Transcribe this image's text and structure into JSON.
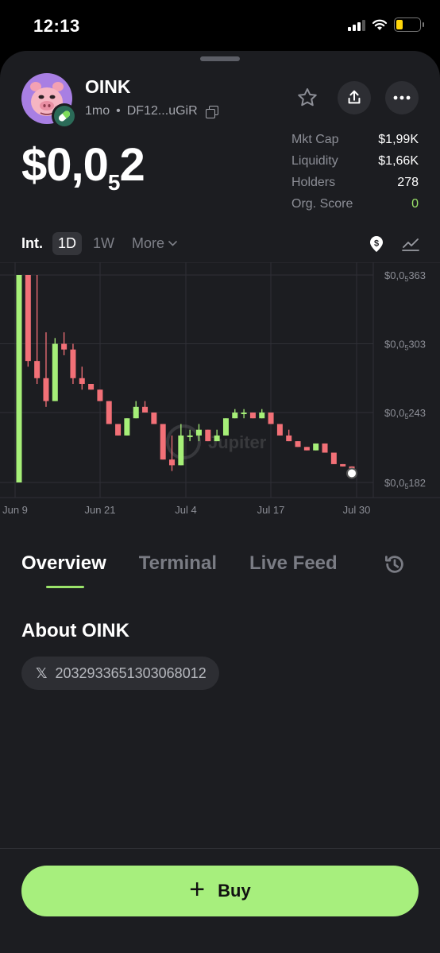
{
  "status": {
    "time": "12:13"
  },
  "token": {
    "name": "OINK",
    "age": "1mo",
    "separator": "•",
    "address": "DF12...uGiR",
    "price_main": "$0,0",
    "price_sub": "5",
    "price_tail": "2"
  },
  "stats": [
    {
      "label": "Mkt Cap",
      "value": "$1,99K",
      "color": "#ffffff"
    },
    {
      "label": "Liquidity",
      "value": "$1,66K",
      "color": "#ffffff"
    },
    {
      "label": "Holders",
      "value": "278",
      "color": "#ffffff"
    },
    {
      "label": "Org. Score",
      "value": "0",
      "color": "#9be46a"
    }
  ],
  "intervals": {
    "int": "Int.",
    "selected": "1D",
    "week": "1W",
    "more": "More"
  },
  "chart_data": {
    "type": "candlestick",
    "watermark": "Jupiter",
    "x_ticks": [
      "Jun 9",
      "Jun 21",
      "Jul 4",
      "Jul 17",
      "Jul 30"
    ],
    "y_ticks": [
      {
        "main": "$0,0",
        "sub": "5",
        "tail": "363",
        "value": 363
      },
      {
        "main": "$0,0",
        "sub": "5",
        "tail": "303",
        "value": 303
      },
      {
        "main": "$0,0",
        "sub": "5",
        "tail": "243",
        "value": 243
      },
      {
        "main": "$0,0",
        "sub": "5",
        "tail": "182",
        "value": 182
      }
    ],
    "ylim": [
      182,
      363
    ],
    "up_color": "#a6ef78",
    "down_color": "#f27077",
    "candles": [
      [
        182,
        363,
        182,
        363
      ],
      [
        363,
        363,
        283,
        288
      ],
      [
        288,
        363,
        268,
        273
      ],
      [
        273,
        313,
        248,
        253
      ],
      [
        253,
        308,
        253,
        303
      ],
      [
        303,
        313,
        293,
        298
      ],
      [
        298,
        303,
        268,
        273
      ],
      [
        273,
        283,
        263,
        268
      ],
      [
        268,
        268,
        263,
        263
      ],
      [
        263,
        263,
        253,
        253
      ],
      [
        253,
        253,
        233,
        233
      ],
      [
        233,
        233,
        223,
        223
      ],
      [
        223,
        238,
        223,
        238
      ],
      [
        238,
        253,
        238,
        248
      ],
      [
        248,
        253,
        243,
        243
      ],
      [
        243,
        243,
        233,
        233
      ],
      [
        233,
        233,
        202,
        202
      ],
      [
        202,
        223,
        192,
        197
      ],
      [
        197,
        233,
        197,
        223
      ],
      [
        223,
        228,
        218,
        223
      ],
      [
        223,
        233,
        218,
        228
      ],
      [
        228,
        228,
        218,
        218
      ],
      [
        218,
        228,
        218,
        223
      ],
      [
        223,
        238,
        223,
        238
      ],
      [
        238,
        246,
        238,
        243
      ],
      [
        243,
        246,
        238,
        243
      ],
      [
        243,
        243,
        238,
        238
      ],
      [
        238,
        246,
        238,
        243
      ],
      [
        243,
        243,
        233,
        233
      ],
      [
        233,
        233,
        223,
        223
      ],
      [
        223,
        228,
        218,
        218
      ],
      [
        218,
        218,
        213,
        213
      ],
      [
        213,
        213,
        210,
        210
      ],
      [
        210,
        216,
        210,
        216
      ],
      [
        216,
        216,
        208,
        208
      ],
      [
        208,
        208,
        198,
        198
      ],
      [
        198,
        198,
        196,
        196
      ],
      [
        196,
        196,
        190,
        190
      ]
    ]
  },
  "tabs": [
    "Overview",
    "Terminal",
    "Live Feed"
  ],
  "about": {
    "title": "About OINK",
    "x_handle": "2032933651303068012"
  },
  "buy": {
    "label": "Buy",
    "color": "#a7ef7d"
  }
}
